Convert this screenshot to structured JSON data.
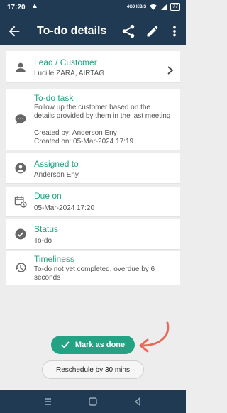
{
  "status": {
    "time": "17:20",
    "warning": "▲",
    "network": "4G0 KB/S",
    "battery": "77"
  },
  "header": {
    "title": "To-do details",
    "back_icon": "arrow-back-icon",
    "share_icon": "share-icon",
    "edit_icon": "pencil-icon",
    "more_icon": "more-vert-icon"
  },
  "cards": {
    "lead": {
      "label": "Lead / Customer",
      "value": "Lucille ZARA, AIRTAG"
    },
    "task": {
      "label": "To-do task",
      "value": "Follow up the customer based on the details provided by them in the last meeting",
      "created_by": "Created by: Anderson Eny",
      "created_on": "Created on: 05-Mar-2024 17:19"
    },
    "assigned": {
      "label": "Assigned to",
      "value": "Anderson Eny"
    },
    "due": {
      "label": "Due on",
      "value": "05-Mar-2024 17:20"
    },
    "status": {
      "label": "Status",
      "value": "To-do"
    },
    "timeliness": {
      "label": "Timeliness",
      "value": "To-do not yet completed, overdue by 6 seconds"
    }
  },
  "actions": {
    "done_label": "Mark as done",
    "reschedule_label": "Reschedule by 30 mins"
  },
  "colors": {
    "header_bg": "#1f3a52",
    "accent": "#23a383",
    "annotation_arrow": "#e86a5a"
  }
}
